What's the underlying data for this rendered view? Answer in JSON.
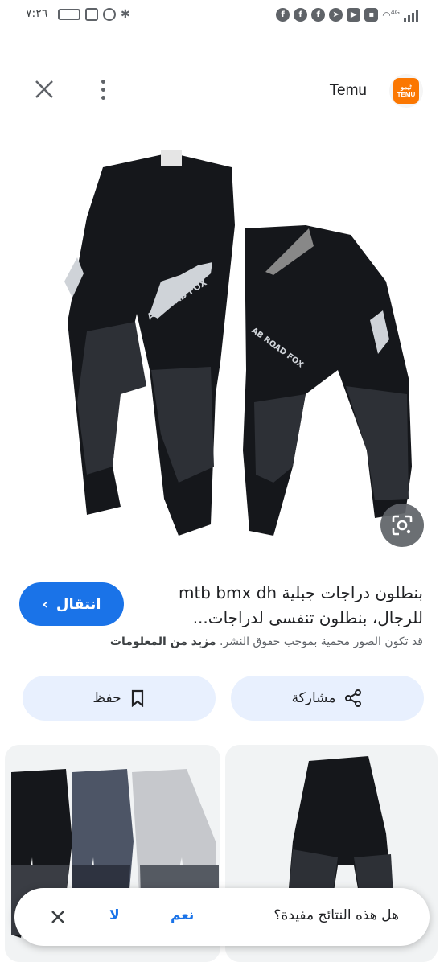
{
  "status_bar": {
    "time": "٧:٢٦",
    "network": "4G"
  },
  "header": {
    "site_name": "Temu",
    "logo_text_top": "ٹیمو",
    "logo_text_bottom": "TEMU",
    "close_icon": "close-icon",
    "more_icon": "more-vert-icon"
  },
  "result": {
    "title_line1": "بنطلون دراجات جبلية mtb bmx dh",
    "title_line2": "للرجال، بنطلون تنفسى لدراجات...",
    "visit_label": "انتقال",
    "copyright_text": "قد تكون الصور محمية بموجب حقوق النشر.",
    "learn_more": "مزيد من المعلومات"
  },
  "actions": {
    "share_label": "مشاركة",
    "save_label": "حفظ"
  },
  "feedback": {
    "question": "هل هذه النتائج مفيدة؟",
    "yes_label": "نعم",
    "no_label": "لا"
  },
  "colors": {
    "accent": "#1a73e8",
    "action_bg": "#e8f0fe",
    "temu_orange": "#fb7701"
  }
}
